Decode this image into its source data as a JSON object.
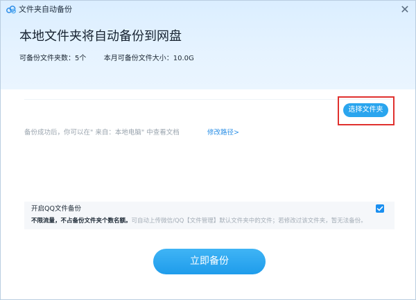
{
  "window": {
    "title": "文件夹自动备份",
    "close_symbol": "✕"
  },
  "header": {
    "headline": "本地文件夹将自动备份到网盘",
    "folder_count_label": "可备份文件夹数：5个",
    "monthly_size_label": "本月可备份文件大小：10.0G"
  },
  "content": {
    "choose_folder_label": "选择文件夹",
    "hint_text": "备份成功后，你可以在\" 来自：本地电脑\" 中查看文档",
    "modify_path_label": "修改路径>"
  },
  "qq_backup": {
    "title": "开启QQ文件备份",
    "desc_strong": "不限流量，不占备份文件夹个数名额。",
    "desc_rest": "可自动上传微信/QQ【文件管理】默认文件夹中的文件；若修改过该文件夹，暂无法备份。",
    "checked": true
  },
  "actions": {
    "backup_now_label": "立即备份"
  },
  "colors": {
    "accent": "#2aa5ee",
    "link": "#2b8fe6",
    "highlight": "#e0302d"
  },
  "icons": {
    "app": "cloud-icon",
    "close": "close-icon",
    "check": "checkmark-icon"
  }
}
